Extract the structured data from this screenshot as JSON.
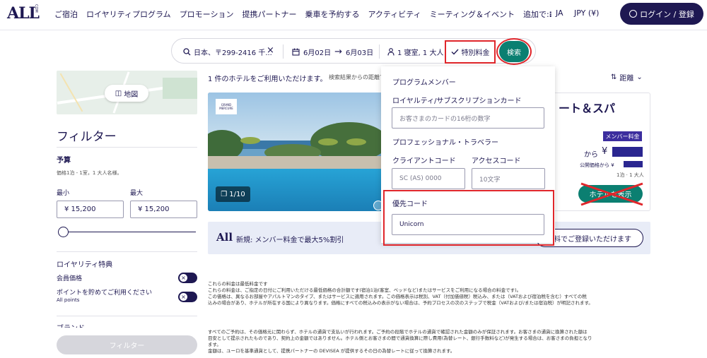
{
  "header": {
    "logo": "ALL",
    "logo_suffix": "COM",
    "nav": [
      "ご宿泊",
      "ロイヤリティプログラム",
      "プロモーション",
      "提携パートナー",
      "乗車を予約する",
      "アクティビティ",
      "ミーティング＆イベント",
      "追加で:"
    ],
    "language": "JA",
    "currency": "JPY (¥)",
    "login_label": "ログイン / 登録"
  },
  "search": {
    "destination": "日本、〒299-2416 千...",
    "clear_icon": "×",
    "check_in": "6月02日",
    "check_out": "6月03日",
    "rooms": "1 寝室, 1 大人",
    "special_rate": "特別料金",
    "search_label": "検索"
  },
  "sidebar": {
    "map_label": "地図",
    "filter_title": "フィルター",
    "budget_title": "予算",
    "budget_note": "価格1泊 - 1室，1 大人名様。",
    "min_label": "最小",
    "max_label": "最大",
    "min_value": "¥ 15,200",
    "max_value": "¥ 15,200",
    "loyalty_title": "ロイヤリティ特典",
    "member_price": "会員価格",
    "points_label": "ポイントを貯めてご利用ください",
    "all_points": "All points",
    "brand_label": "ブランド",
    "filter_button": "フィルター"
  },
  "results": {
    "count": "1 件のホテルをご利用いただけます。",
    "note": "検索結果からの距離で",
    "sort_label": "距離",
    "hotel": {
      "logo_text": "GRAND MERCURE",
      "photo_count": "1/10",
      "name": "ート＆スパ",
      "badge": "メンバー料金",
      "from": "から",
      "yen": "¥",
      "public_price": "公開価格から ¥",
      "per_night": "1泊 · 1 大人",
      "button": "ホテルを表示"
    },
    "promo_logo": "All",
    "promo_text": "新規: メンバー料金で最大5%割引",
    "promo_button": "料でご登録いただけます"
  },
  "dropdown": {
    "program_title": "プログラムメンバー",
    "loyalty_card_label": "ロイヤルティ/サブスクリプションカード",
    "card_placeholder": "お客さまのカードの16桁の数字",
    "professional_label": "プロフェッショナル・トラベラー",
    "client_code_label": "クライアントコード",
    "client_code_placeholder": "SC (AS) 0000",
    "access_code_label": "アクセスコード",
    "access_code_placeholder": "10文字",
    "preferred_label": "優先コード",
    "preferred_value": "Unicorn"
  },
  "disclaimers": {
    "block1": [
      "これらの料金は最低料金です",
      "これらの料金は、ご指定の日付にご利用いただける最低価格の合計額です(宿泊1泊(客室、ベッドなど)またはサービスをご利用になる場合の料金です)。",
      "この価格は、異なるお部屋やアパルトマンのタイプ、またはサービスに適用されます。この価格表示は税別、VAT（付加価値税）税込み、または（VATおよび宿泊税を含む）すべての税",
      "込みの場合があり、ホテルが所在する国により異なります。価格にすべての税込みの表示がない場合は、予約プロセスの次のステップで税金（VATおよび/または宿泊税）が明記されます。"
    ],
    "block2": [
      "すべてのご予約は、その価格元に関わらず、ホテルの通貨で支払いが行われます。ご予約の段階でホテルの通貨で確認された金額のみが保証されます。お客さまの通貨に換算された額は",
      "目安として提示されたものであり、契約上の金額ではありません。ホテル側とお客さまの間で通貨換算に際し費用(為替レート、銀行手数料など)が発生する場合は、お客さまの負担となり",
      "ます。",
      "金額は、ユーロを基準通貨として、提携パートナーの DEVISEA が提供するその日の為替レートに従って換算されます。"
    ]
  },
  "colors": {
    "navy": "#1e1852",
    "teal": "#0b7f71",
    "annotation_red": "#e0262b",
    "badge_purple": "#3c2e9e"
  },
  "icons": [
    "search-icon",
    "calendar-icon",
    "arrow-right-icon",
    "person-icon",
    "check-icon",
    "user-icon",
    "map-icon",
    "sort-icon",
    "chevron-down-icon",
    "gallery-icon"
  ]
}
